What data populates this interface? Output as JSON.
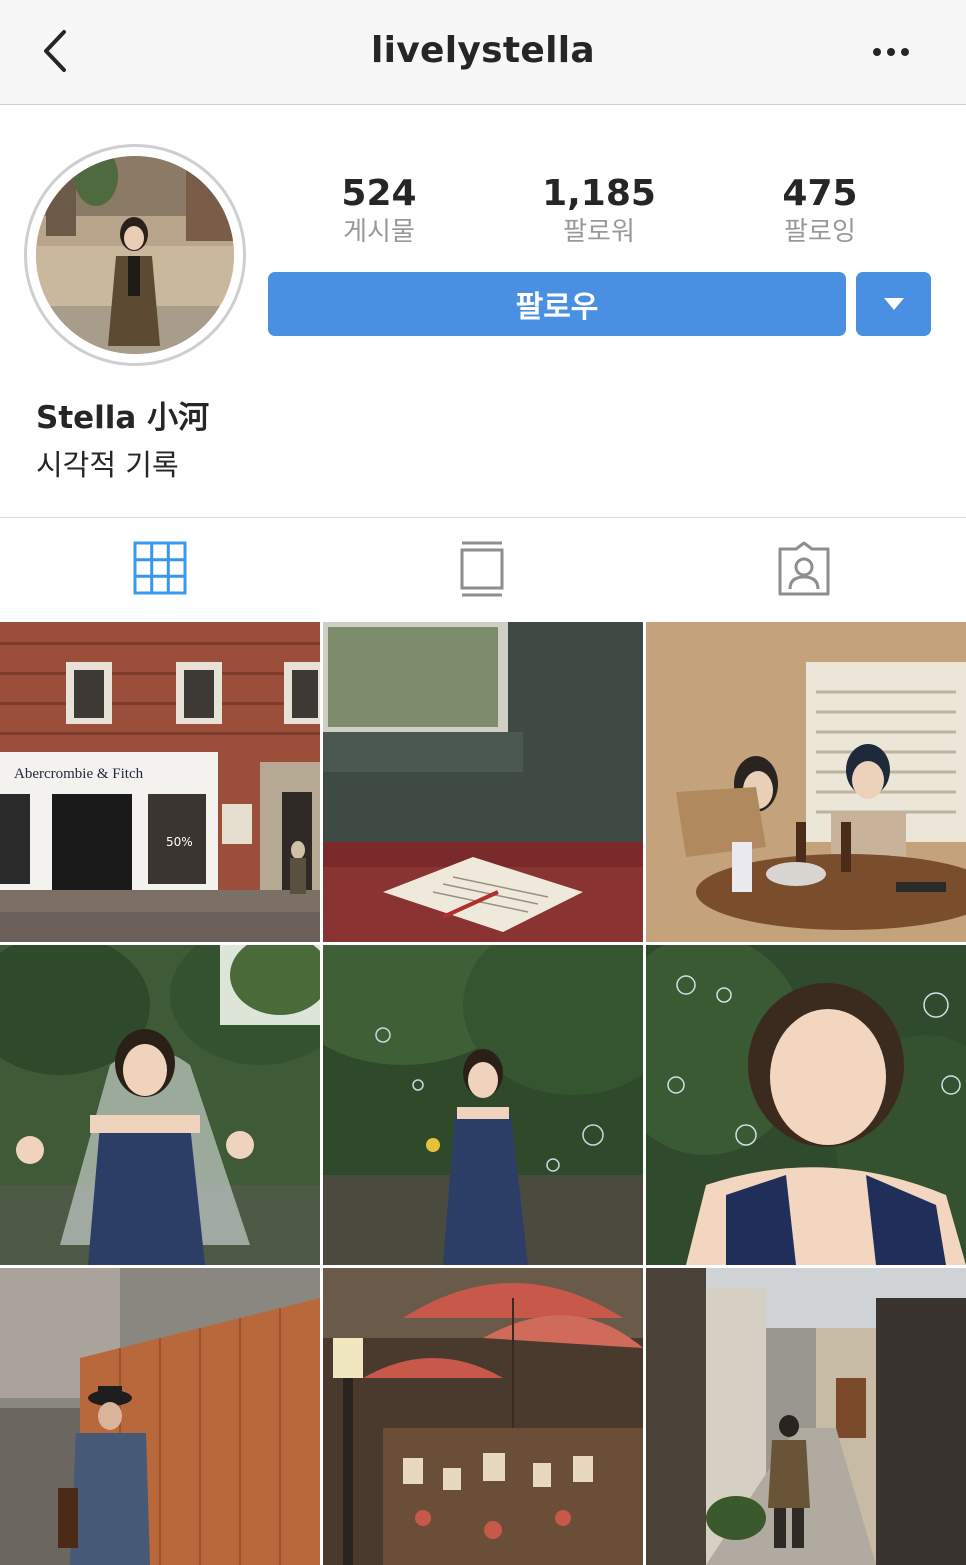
{
  "header": {
    "title": "livelystella",
    "back_icon": "chevron-left-icon",
    "more_icon": "more-dots-icon"
  },
  "profile": {
    "stats": [
      {
        "value": "524",
        "label": "게시물"
      },
      {
        "value": "1,185",
        "label": "팔로워"
      },
      {
        "value": "475",
        "label": "팔로잉"
      }
    ],
    "follow_label": "팔로우",
    "name": "Stella 小河",
    "bio": "시각적 기록"
  },
  "tabs": [
    {
      "icon": "grid-icon",
      "active": true
    },
    {
      "icon": "feed-list-icon",
      "active": false
    },
    {
      "icon": "tagged-photos-icon",
      "active": false
    }
  ],
  "photos": [
    {
      "subject": "brick storefront",
      "sign": "Abercrombie & Fitch",
      "window_tag": "50%"
    },
    {
      "subject": "open notebook on bed"
    },
    {
      "subject": "two women at cafe table"
    },
    {
      "subject": "woman in blue dress with veil"
    },
    {
      "subject": "woman in garden with bubbles"
    },
    {
      "subject": "smiling woman close-up with bubbles"
    },
    {
      "subject": "old man by wooden fence"
    },
    {
      "subject": "red umbrellas and shop"
    },
    {
      "subject": "man walking in alley"
    }
  ],
  "colors": {
    "accent": "#4a90e2",
    "active_tab": "#3897f0",
    "inactive_tab": "#8e8e8e"
  }
}
